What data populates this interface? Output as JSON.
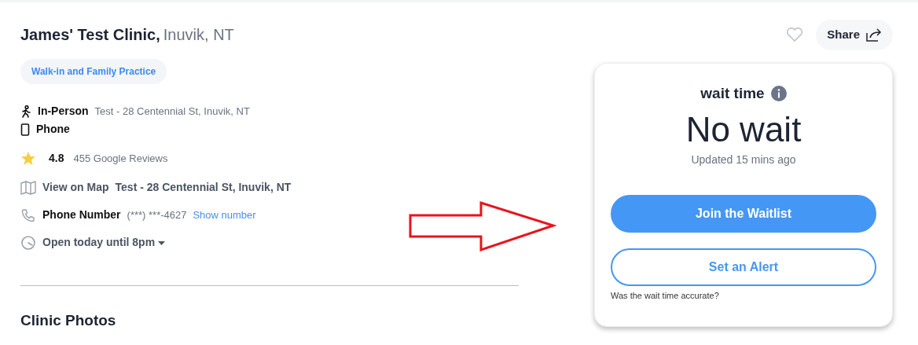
{
  "clinic": {
    "name": "James' Test Clinic,",
    "location": "Inuvik, NT",
    "favorite": false,
    "share": "Share"
  },
  "tag": "Walk-in and Family Practice",
  "visit_types": [
    {
      "kind": "in_person",
      "label": "In-Person",
      "address": "Test - 28 Centennial St, Inuvik, NT"
    },
    {
      "kind": "phone",
      "label": "Phone"
    }
  ],
  "rating": {
    "score": "4.8",
    "reviews": "455 Google Reviews"
  },
  "details": [
    {
      "kind": "map",
      "label": "View on Map",
      "value": "Test - 28 Centennial St, Inuvik, NT"
    },
    {
      "kind": "phone",
      "label": "Phone Number",
      "value": "(***) ***-4627",
      "link": "Show number"
    },
    {
      "kind": "hours",
      "label": "Open today until 8pm",
      "expanded": false
    }
  ],
  "section_title": "Clinic Photos",
  "wait_card": {
    "title": "wait time",
    "status": "No wait",
    "updated": "Updated 15 mins ago",
    "buttons": [
      {
        "kind": "primary",
        "label": "Join the Waitlist"
      },
      {
        "kind": "outline",
        "label": "Set an Alert"
      }
    ],
    "feedback": "Was the wait time accurate?"
  }
}
